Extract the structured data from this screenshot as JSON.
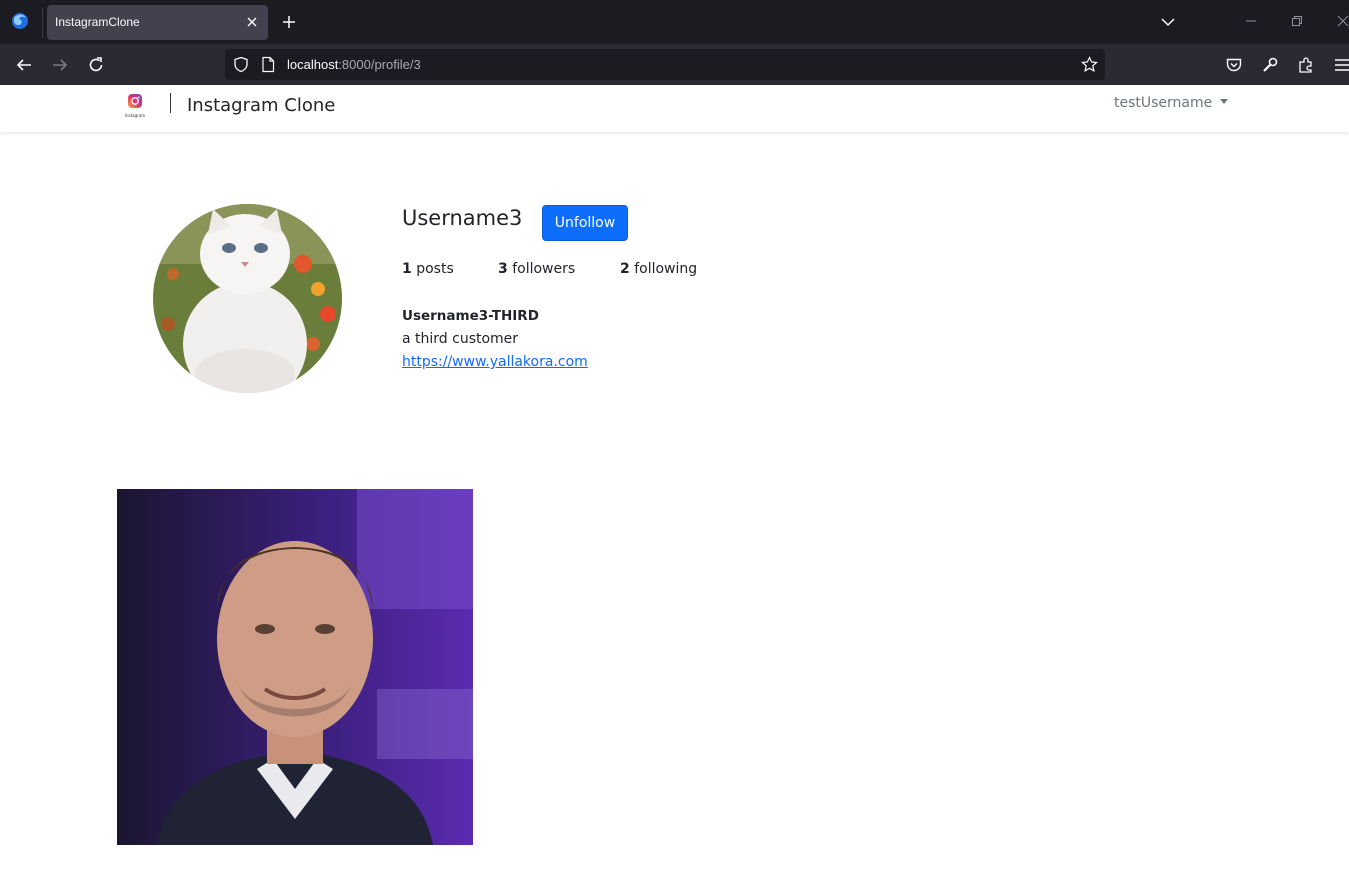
{
  "browser": {
    "tab_title": "InstagramClone",
    "url_host": "localhost",
    "url_rest": ":8000/profile/3"
  },
  "app": {
    "brand": "Instagram Clone",
    "logo_caption": "Instagram",
    "user_menu_label": "testUsername"
  },
  "profile": {
    "username": "Username3",
    "follow_button_label": "Unfollow",
    "stats": {
      "posts_count": "1",
      "posts_label": "posts",
      "followers_count": "3",
      "followers_label": "followers",
      "following_count": "2",
      "following_label": "following"
    },
    "full_name": "Username3-THIRD",
    "bio": "a third customer",
    "website": "https://www.yallakora.com"
  },
  "colors": {
    "primary": "#0d6efd",
    "chrome_dark": "#1c1b22",
    "toolbar": "#2b2a33"
  }
}
